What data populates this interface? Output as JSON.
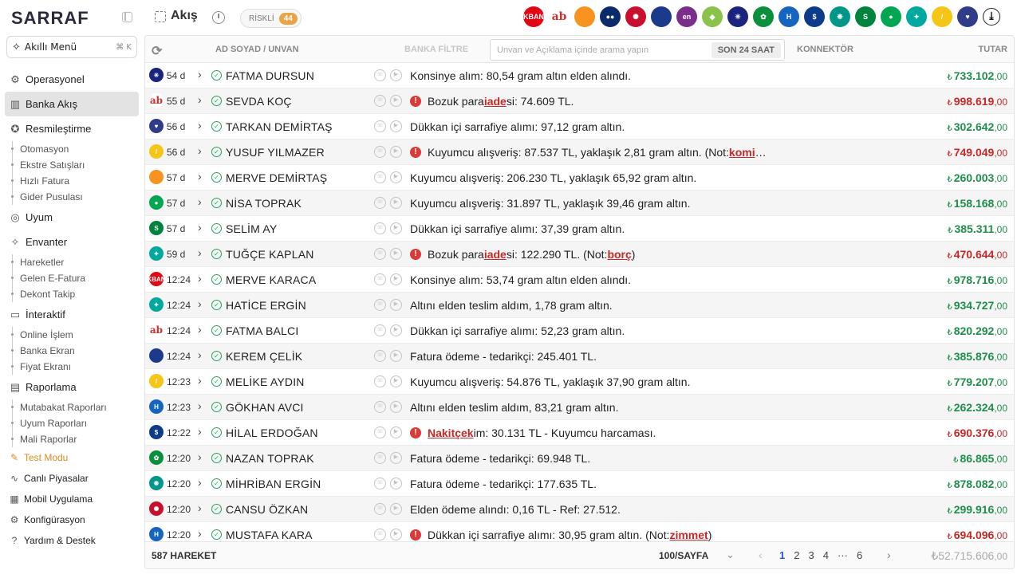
{
  "sidebar": {
    "logo": "SARRAF",
    "smart_menu": "Akıllı Menü",
    "smart_shortcut": "⌘ K",
    "items": [
      {
        "label": "Operasyonel",
        "icon": "gear-people-icon"
      },
      {
        "label": "Banka Akış",
        "icon": "bank-flow-icon"
      },
      {
        "label": "Resmileştirme",
        "icon": "badge-icon",
        "subs": [
          "Otomasyon",
          "Ekstre Satışları",
          "Hızlı Fatura",
          "Gider Pusulası"
        ]
      },
      {
        "label": "Uyum",
        "icon": "fingerprint-icon"
      },
      {
        "label": "Envanter",
        "icon": "sparkle-icon",
        "subs": [
          "Hareketler",
          "Gelen E-Fatura",
          "Dekont Takip"
        ]
      },
      {
        "label": "İnteraktif",
        "icon": "screen-icon",
        "subs": [
          "Online İşlem",
          "Banka Ekran",
          "Fiyat Ekranı"
        ]
      },
      {
        "label": "Raporlama",
        "icon": "report-icon",
        "subs": [
          "Mutabakat Raporları",
          "Uyum Raporları",
          "Mali Raporlar"
        ]
      }
    ],
    "bottom": [
      {
        "label": "Test Modu",
        "icon": "test-icon"
      },
      {
        "label": "Canlı Piyasalar",
        "icon": "pulse-icon"
      },
      {
        "label": "Mobil Uygulama",
        "icon": "grid-icon"
      },
      {
        "label": "Konfigürasyon",
        "icon": "cog-icon"
      },
      {
        "label": "Yardım & Destek",
        "icon": "help-icon"
      }
    ]
  },
  "topbar": {
    "title": "Akış",
    "risky_label": "RİSKLİ",
    "risky_count": "44",
    "banks": [
      {
        "name": "akbank",
        "color": "#e30613",
        "text": "AKBANK"
      },
      {
        "name": "ab",
        "color": "#ffffff",
        "text": "ab"
      },
      {
        "name": "flame",
        "color": "#f7931e",
        "text": ""
      },
      {
        "name": "dots",
        "color": "#0a2a6b",
        "text": "●●"
      },
      {
        "name": "wheel",
        "color": "#c8102e",
        "text": "✺"
      },
      {
        "name": "swirl",
        "color": "#1b3a8c",
        "text": ""
      },
      {
        "name": "en",
        "color": "#7a2d8a",
        "text": "en"
      },
      {
        "name": "leaf",
        "color": "#8bc34a",
        "text": "◆"
      },
      {
        "name": "star",
        "color": "#1a237e",
        "text": "✳"
      },
      {
        "name": "flower",
        "color": "#0a8f3c",
        "text": "✿"
      },
      {
        "name": "halkbank",
        "color": "#1565c0",
        "text": "H"
      },
      {
        "name": "dollar",
        "color": "#0d3b8c",
        "text": "$"
      },
      {
        "name": "ziraat",
        "color": "#009688",
        "text": "❋"
      },
      {
        "name": "sekerbank",
        "color": "#00843d",
        "text": "S"
      },
      {
        "name": "globe",
        "color": "#00a651",
        "text": "●"
      },
      {
        "name": "kuveyt",
        "color": "#00a99d",
        "text": "✦"
      },
      {
        "name": "vakif",
        "color": "#f5c518",
        "text": "/"
      },
      {
        "name": "heart",
        "color": "#2e3c8a",
        "text": "♥"
      },
      {
        "name": "down",
        "color": "#ffffff",
        "text": "⤓"
      }
    ]
  },
  "table": {
    "headers": {
      "name": "AD SOYAD / UNVAN",
      "bank": "BANKA FİLTRE",
      "search_placeholder": "Unvan ve Açıklama içinde arama yapın",
      "last": "SON 24 SAAT",
      "connector": "KONNEKTÖR",
      "amount": "TUTAR"
    },
    "rows": [
      {
        "bank": "star",
        "time": "54 d",
        "name": "FATMA DURSUN",
        "desc": "Konsinye alım: 80,54 gram altın elden alındı.",
        "warn": false,
        "amount": "733.102",
        "dec": ",00",
        "sign": "pos"
      },
      {
        "bank": "ab",
        "time": "55 d",
        "name": "SEVDA KOÇ",
        "desc_parts": [
          "Bozuk para ",
          "iade",
          "si: 74.609 TL."
        ],
        "warn": true,
        "amount": "998.619",
        "dec": ",00",
        "sign": "neg"
      },
      {
        "bank": "heart",
        "time": "56 d",
        "name": "TARKAN DEMİRTAŞ",
        "desc": "Dükkan içi sarrafiye alımı: 97,12 gram altın.",
        "warn": false,
        "amount": "302.642",
        "dec": ",00",
        "sign": "pos"
      },
      {
        "bank": "vakif",
        "time": "56 d",
        "name": "YUSUF YILMAZER",
        "desc_parts": [
          "Kuyumcu alışveriş: 87.537 TL, yaklaşık 2,81 gram altın. (Not: ",
          "komi",
          "…"
        ],
        "warn": true,
        "amount": "749.049",
        "dec": ",00",
        "sign": "neg"
      },
      {
        "bank": "flame",
        "time": "57 d",
        "name": "MERVE DEMİRTAŞ",
        "desc": "Kuyumcu alışveriş: 206.230 TL, yaklaşık 65,92 gram altın.",
        "warn": false,
        "amount": "260.003",
        "dec": ",00",
        "sign": "pos"
      },
      {
        "bank": "globe",
        "time": "57 d",
        "name": "NİSA TOPRAK",
        "desc": "Kuyumcu alışveriş: 31.897 TL, yaklaşık 39,46 gram altın.",
        "warn": false,
        "amount": "158.168",
        "dec": ",00",
        "sign": "pos"
      },
      {
        "bank": "sekerbank",
        "time": "57 d",
        "name": "SELİM AY",
        "desc": "Dükkan içi sarrafiye alımı: 37,39 gram altın.",
        "warn": false,
        "amount": "385.311",
        "dec": ",00",
        "sign": "pos"
      },
      {
        "bank": "kuveyt",
        "time": "59 d",
        "name": "TUĞÇE KAPLAN",
        "desc_parts": [
          "Bozuk para ",
          "iade",
          "si: 122.290 TL. (Not: ",
          "borç",
          ")"
        ],
        "warn": true,
        "amount": "470.644",
        "dec": ",00",
        "sign": "neg"
      },
      {
        "bank": "akbank",
        "time": "12:24",
        "name": "MERVE KARACA",
        "desc": "Konsinye alım: 53,74 gram altın elden alındı.",
        "warn": false,
        "amount": "978.716",
        "dec": ",00",
        "sign": "pos"
      },
      {
        "bank": "kuveyt",
        "time": "12:24",
        "name": "HATİCE ERGİN",
        "desc": "Altını elden teslim aldım, 1,78 gram altın.",
        "warn": false,
        "amount": "934.727",
        "dec": ",00",
        "sign": "pos"
      },
      {
        "bank": "ab",
        "time": "12:24",
        "name": "FATMA BALCI",
        "desc": "Dükkan içi sarrafiye alımı: 52,23 gram altın.",
        "warn": false,
        "amount": "820.292",
        "dec": ",00",
        "sign": "pos"
      },
      {
        "bank": "swirl",
        "time": "12:24",
        "name": "KEREM ÇELİK",
        "desc": "Fatura ödeme - tedarikçi: 245.401 TL.",
        "warn": false,
        "amount": "385.876",
        "dec": ",00",
        "sign": "pos"
      },
      {
        "bank": "vakif",
        "time": "12:23",
        "name": "MELİKE AYDIN",
        "desc": "Kuyumcu alışveriş: 54.876 TL, yaklaşık 37,90 gram altın.",
        "warn": false,
        "amount": "779.207",
        "dec": ",00",
        "sign": "pos"
      },
      {
        "bank": "halkbank",
        "time": "12:23",
        "name": "GÖKHAN AVCI",
        "desc": "Altını elden teslim aldım, 83,21 gram altın.",
        "warn": false,
        "amount": "262.324",
        "dec": ",00",
        "sign": "pos"
      },
      {
        "bank": "dollar",
        "time": "12:22",
        "name": "HİLAL ERDOĞAN",
        "desc_parts": [
          "",
          "Nakit",
          " ",
          "çek",
          "im: 30.131 TL - Kuyumcu harcaması."
        ],
        "warn": true,
        "amount": "690.376",
        "dec": ",00",
        "sign": "neg"
      },
      {
        "bank": "flower",
        "time": "12:20",
        "name": "NAZAN TOPRAK",
        "desc": "Fatura ödeme - tedarikçi: 69.948 TL.",
        "warn": false,
        "amount": "86.865",
        "dec": ",00",
        "sign": "pos"
      },
      {
        "bank": "ziraat",
        "time": "12:20",
        "name": "MİHRİBAN ERGİN",
        "desc": "Fatura ödeme - tedarikçi: 177.635 TL.",
        "warn": false,
        "amount": "878.082",
        "dec": ",00",
        "sign": "pos"
      },
      {
        "bank": "wheel",
        "time": "12:20",
        "name": "CANSU ÖZKAN",
        "desc": "Elden ödeme alındı: 0,16 TL - Ref: 27.512.",
        "warn": false,
        "amount": "299.916",
        "dec": ",00",
        "sign": "pos"
      },
      {
        "bank": "halkbank",
        "time": "12:20",
        "name": "MUSTAFA KARA",
        "desc_parts": [
          "Dükkan içi sarrafiye alımı: 30,95 gram altın. (Not: ",
          "zimmet",
          ")"
        ],
        "warn": true,
        "amount": "694.096",
        "dec": ",00",
        "sign": "neg"
      }
    ],
    "currency": "₺",
    "footer": {
      "count": "587 HAREKET",
      "per_page": "100/SAYFA",
      "pages": [
        "1",
        "2",
        "3",
        "4",
        "···",
        "6"
      ],
      "current": "1",
      "total": "52.715.606",
      "total_dec": ",00"
    }
  }
}
